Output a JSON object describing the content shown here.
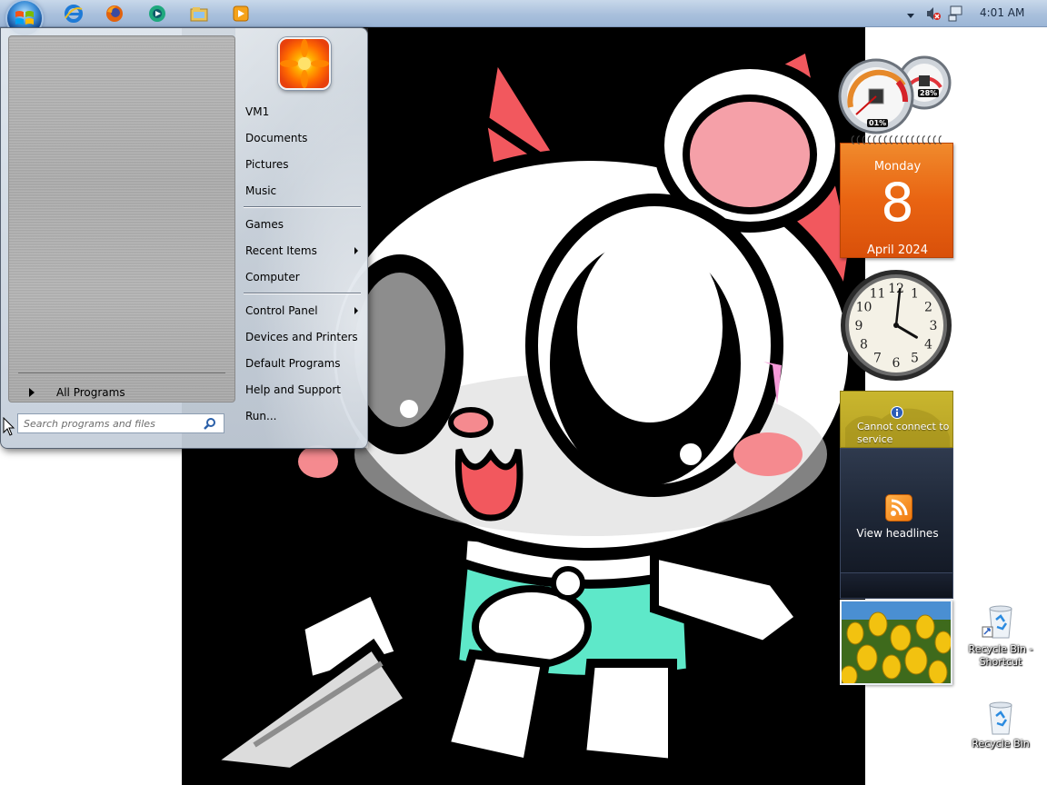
{
  "taskbar": {
    "pinned": [
      {
        "name": "internet-explorer-icon"
      },
      {
        "name": "firefox-icon"
      },
      {
        "name": "windows-media-center-icon"
      },
      {
        "name": "windows-explorer-icon"
      },
      {
        "name": "windows-media-player-icon"
      }
    ],
    "clock": "4:01 AM"
  },
  "start_menu": {
    "all_programs": "All Programs",
    "search_placeholder": "Search programs and files",
    "items": {
      "user": "VM1",
      "documents": "Documents",
      "pictures": "Pictures",
      "music": "Music",
      "games": "Games",
      "recent_items": "Recent Items",
      "computer": "Computer",
      "control_panel": "Control Panel",
      "devices_printers": "Devices and Printers",
      "default_programs": "Default Programs",
      "help_support": "Help and Support",
      "run": "Run..."
    }
  },
  "gadgets": {
    "cpu_meter": {
      "cpu": "01%",
      "memory": "28%"
    },
    "calendar": {
      "day": "Monday",
      "date": "8",
      "month": "April 2024"
    },
    "clock": {
      "hour": 4,
      "minute": 1,
      "numbers": [
        "12",
        "1",
        "2",
        "3",
        "4",
        "5",
        "6",
        "7",
        "8",
        "9",
        "10",
        "11"
      ]
    },
    "feed_status": "Cannot connect to service",
    "feed_headlines": "View headlines"
  },
  "desktop_icons": {
    "recycle_shortcut": "Recycle Bin - Shortcut",
    "recycle_bin": "Recycle Bin"
  },
  "colors": {
    "calendar_orange": "#e96412",
    "wallpaper_bg": "#000000",
    "accent_blue": "#3d8fd8"
  }
}
